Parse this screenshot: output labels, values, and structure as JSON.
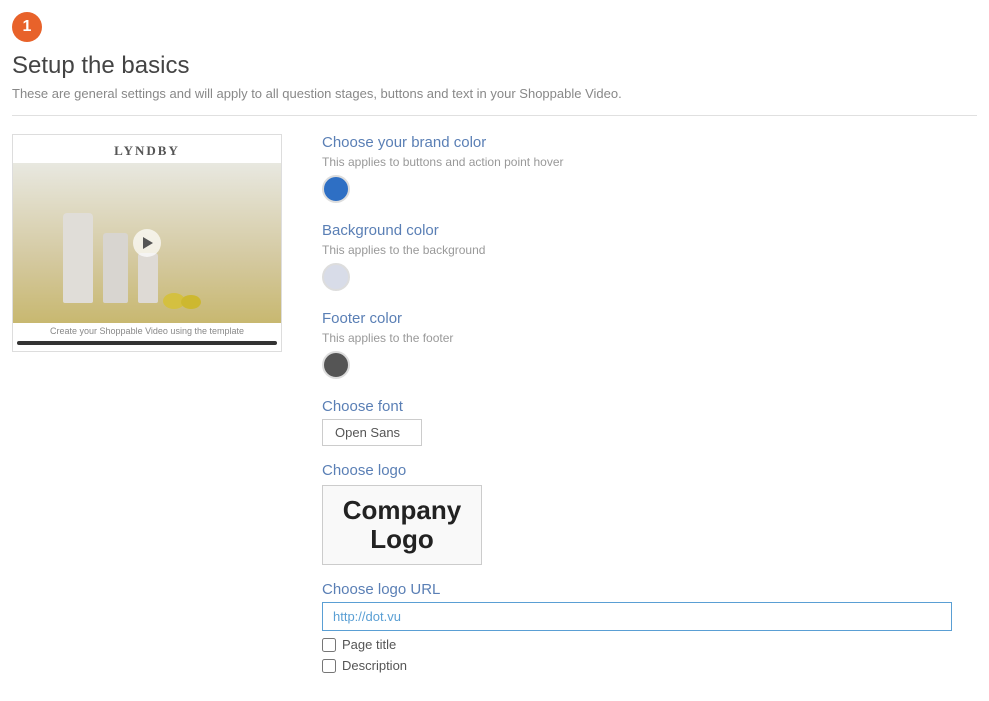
{
  "step": {
    "number": "1"
  },
  "header": {
    "title": "Setup the basics",
    "subtitle": "These are general settings and will apply to all question stages, buttons and text in your Shoppable Video."
  },
  "preview": {
    "brand_name": "LYNDBY",
    "caption": "Create your Shoppable Video using the template",
    "progress_label": "progress bar"
  },
  "settings": {
    "brand_color": {
      "label": "Choose your brand color",
      "description": "This applies to buttons and action point hover",
      "color": "#2e6fc4"
    },
    "background_color": {
      "label": "Background color",
      "description": "This applies to the background",
      "color": "#d8dce8"
    },
    "footer_color": {
      "label": "Footer color",
      "description": "This applies to the footer",
      "color": "#555555"
    },
    "font": {
      "label": "Choose font",
      "value": "Open Sans"
    },
    "logo": {
      "label": "Choose logo",
      "text_line1": "Company",
      "text_line2": "Logo"
    },
    "logo_url": {
      "label": "Choose logo URL",
      "value": "http://dot.vu"
    },
    "page_title": {
      "label": "Page title",
      "checked": false
    },
    "description": {
      "label": "Description",
      "checked": false
    }
  }
}
